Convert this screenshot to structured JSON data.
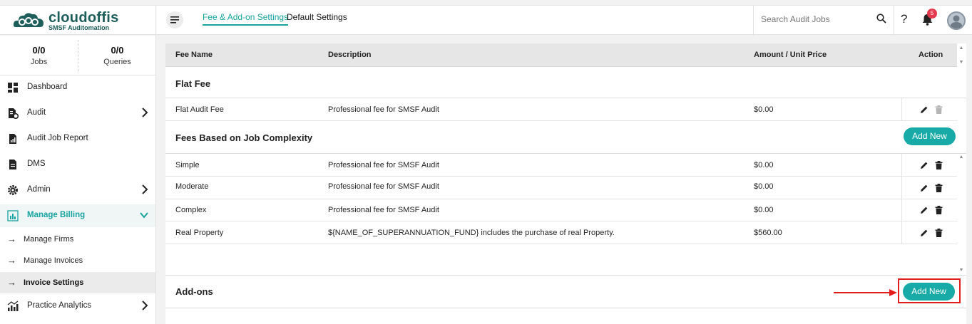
{
  "header": {
    "brand": "cloudoffis",
    "tagline": "SMSF Auditomation",
    "tabs": [
      {
        "label": "Fee & Add-on Settings",
        "active": true
      },
      {
        "label": "Default Settings",
        "active": false
      }
    ],
    "search_placeholder": "Search Audit Jobs",
    "help_label": "?",
    "notification_count": "5",
    "accent_color": "#17a3a0"
  },
  "sidebar": {
    "stats": [
      {
        "value": "0/0",
        "label": "Jobs"
      },
      {
        "value": "0/0",
        "label": "Queries"
      }
    ],
    "items": [
      {
        "label": "Dashboard",
        "icon": "dashboard-icon"
      },
      {
        "label": "Audit",
        "icon": "audit-icon"
      },
      {
        "label": "Audit Job Report",
        "icon": "report-icon"
      },
      {
        "label": "DMS",
        "icon": "document-icon"
      },
      {
        "label": "Admin",
        "icon": "gear-icon"
      },
      {
        "label": "Manage Billing",
        "icon": "billing-icon"
      },
      {
        "label": "Practice Analytics",
        "icon": "analytics-icon"
      }
    ],
    "sub_items": [
      {
        "label": "Manage Firms"
      },
      {
        "label": "Manage Invoices"
      },
      {
        "label": "Invoice Settings"
      }
    ]
  },
  "table": {
    "columns": [
      "Fee Name",
      "Description",
      "Amount / Unit Price",
      "Action"
    ],
    "flat_fee": {
      "title": "Flat Fee",
      "rows": [
        {
          "name": "Flat Audit Fee",
          "description": "Professional fee for SMSF Audit",
          "amount": "$0.00"
        }
      ]
    },
    "complexity": {
      "title": "Fees Based on Job Complexity",
      "add_label": "Add New",
      "rows": [
        {
          "name": "Simple",
          "description": "Professional fee for SMSF Audit",
          "amount": "$0.00"
        },
        {
          "name": "Moderate",
          "description": "Professional fee for SMSF Audit",
          "amount": "$0.00"
        },
        {
          "name": "Complex",
          "description": "Professional fee for SMSF Audit",
          "amount": "$0.00"
        },
        {
          "name": "Real Property",
          "description": "${NAME_OF_SUPERANNUATION_FUND} includes the purchase of real Property.",
          "amount": "$560.00"
        }
      ]
    },
    "addons": {
      "title": "Add-ons",
      "add_label": "Add New"
    }
  }
}
